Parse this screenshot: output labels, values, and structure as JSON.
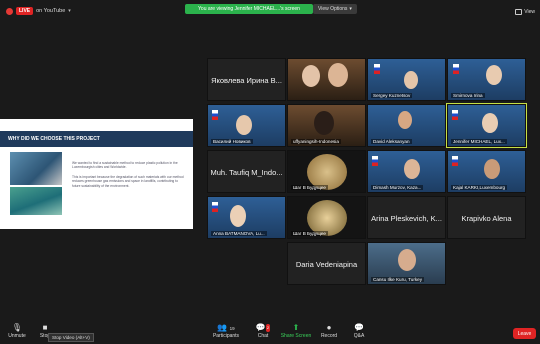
{
  "topbar": {
    "live_badge": "LIVE",
    "live_destination": "on YouTube",
    "share_notice": "You are viewing Jennifer MICHAEL...'s screen",
    "view_options": "View Options",
    "view_label": "View"
  },
  "slide": {
    "title": "WHY DID WE CHOOSE THIS PROJECT",
    "bullet1": "We wanted to find a sustainable method to reduce plastic pollution in the Luxembourgish cities and Worldwide.",
    "bullet2": "This is important because the degradation of such materials with our method reduces greenhouse gas emissions and space in landfills, contributing to future sustainability of the environment."
  },
  "participants": [
    {
      "name": "Яковлева Ирина В...",
      "display": "Яковлева Ирина В..."
    },
    {
      "name": "",
      "display": ""
    },
    {
      "name": "",
      "display": ""
    },
    {
      "name": "",
      "display": ""
    },
    {
      "name": "Sergey Kuznetsov"
    },
    {
      "name": "Smirnova Irina"
    },
    {
      "name": "Василий Новиков"
    },
    {
      "name": "uffyaningsih-Indonesia"
    },
    {
      "name": "David Aleksanyan"
    },
    {
      "name": "Jennifer MICHAEL, Lux..."
    },
    {
      "display": "Muh. Taufiq M_Indo..."
    },
    {
      "name": "Шаг В Будущее"
    },
    {
      "name": "Dimash Murzov, Kaza..."
    },
    {
      "name": "Kajal KARKI,Luxembourg"
    },
    {
      "name": "Anna BATMANOVA, Lu..."
    },
    {
      "name": "Шаг В Будущее"
    },
    {
      "display": "Arina Pleskevich, K..."
    },
    {
      "display": "Krapivko Alena"
    },
    {
      "display": "Daria Vedeniapina"
    },
    {
      "name": "Cansu Ilke Kuru, Turkey"
    }
  ],
  "toolbar": {
    "unmute": "Unmute",
    "stop_video": "Stop",
    "stop_video_tooltip": "Stop Video (Alt+V)",
    "participants": "Participants",
    "participant_count": "19",
    "chat": "Chat",
    "chat_badge": "2",
    "share_screen": "Share Screen",
    "record": "Record",
    "qa": "Q&A",
    "leave": "Leave"
  },
  "colors": {
    "live_red": "#e02424",
    "share_green": "#2bb24c",
    "active_speaker": "#c6e045",
    "slide_header": "#1f3a5c"
  }
}
